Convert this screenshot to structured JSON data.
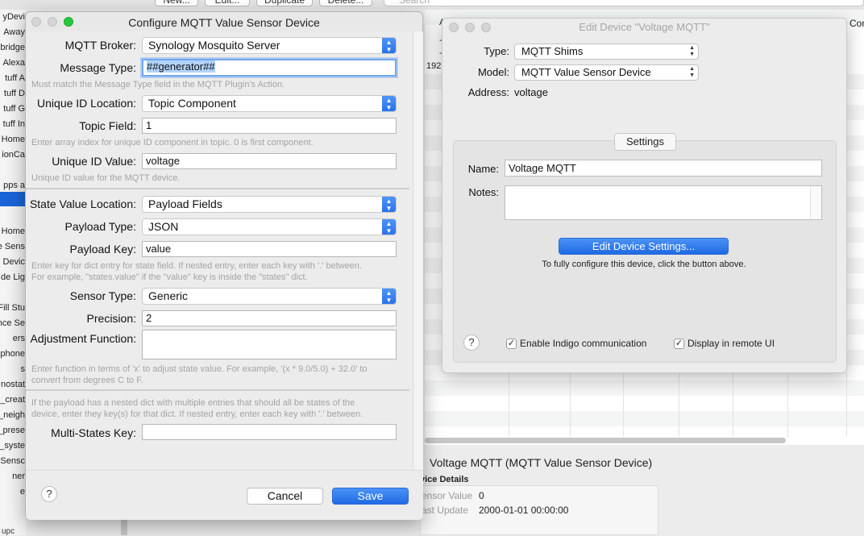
{
  "background": {
    "toolbar_buttons": [
      "New...",
      "Edit...",
      "Duplicate",
      "Delete..."
    ],
    "search_placeholder": "Search",
    "column_header_partial": "Con",
    "sidebar_items": [
      "yDevi",
      "Away",
      "bridge",
      "Alexa",
      "tuff A",
      "tuff D",
      "tuff G",
      "tuff In",
      "Home",
      "ionCa",
      "",
      "pps a",
      "",
      "",
      "Home",
      "e Sens",
      "Devic",
      "de Lig",
      "",
      "Fill Stu",
      "nce Se",
      "ers",
      "phone",
      "s",
      "nostat",
      "_creat",
      "_neigh",
      "_prese",
      "_syste",
      "Sensc",
      "ner",
      "e"
    ],
    "list_partial_letters": [
      "A",
      "-",
      "-",
      "192"
    ],
    "detail": {
      "title": "Voltage MQTT (MQTT Value Sensor Device)",
      "section": "vice Details",
      "rows": [
        {
          "key": "ensor Value",
          "value": "0"
        },
        {
          "key": "ast Update",
          "value": "2000-01-01 00:00:00"
        }
      ],
      "bottom_left": "upc"
    }
  },
  "config_dialog": {
    "title": "Configure MQTT Value Sensor Device",
    "broker": {
      "label": "MQTT Broker:",
      "value": "Synology Mosquito Server"
    },
    "message_type": {
      "label": "Message Type:",
      "value": "##generator##",
      "hint": "Must match the Message Type field in the MQTT Plugin's Action."
    },
    "unique_id_location": {
      "label": "Unique ID Location:",
      "value": "Topic Component"
    },
    "topic_field": {
      "label": "Topic Field:",
      "value": "1",
      "hint": "Enter array index for unique ID component in topic.  0 is first component."
    },
    "unique_id_value": {
      "label": "Unique ID Value:",
      "value": "voltage",
      "hint": "Unique ID value for the MQTT device."
    },
    "state_value_location": {
      "label": "State Value Location:",
      "value": "Payload Fields"
    },
    "payload_type": {
      "label": "Payload Type:",
      "value": "JSON"
    },
    "payload_key": {
      "label": "Payload Key:",
      "value": "value",
      "hint1": "Enter key for dict entry for state field.  If nested entry, enter each key with '.' between.",
      "hint2": "For example, \"states.value\" if the \"value\" key is inside the \"states\" dict."
    },
    "sensor_type": {
      "label": "Sensor Type:",
      "value": "Generic"
    },
    "precision": {
      "label": "Precision:",
      "value": "2"
    },
    "adjustment_function": {
      "label": "Adjustment Function:",
      "value": "",
      "hint1": "Enter function in terms of 'x' to adjust state value. For example, '(x * 9.0/5.0) + 32.0' to",
      "hint2": "convert from degrees C to F."
    },
    "multi_states_hint1": "If the payload has a nested dict with multiple entries that should all be states of the",
    "multi_states_hint2": "device, enter they key(s) for that dict.  If nested entry, enter each key with '.' between.",
    "multi_states_key": {
      "label": "Multi-States Key:",
      "value": ""
    },
    "help_label": "?",
    "cancel_label": "Cancel",
    "save_label": "Save"
  },
  "edit_device": {
    "title": "Edit Device \"Voltage MQTT\"",
    "type_label": "Type:",
    "type_value": "MQTT Shims",
    "model_label": "Model:",
    "model_value": "MQTT Value Sensor Device",
    "address_label": "Address:",
    "address_value": "voltage",
    "settings_label": "Settings",
    "name_label": "Name:",
    "name_value": "Voltage MQTT",
    "notes_label": "Notes:",
    "notes_value": "",
    "edit_settings_button": "Edit Device Settings...",
    "configure_hint": "To fully configure this device, click the button above.",
    "help_label": "?",
    "enable_comm_label": "Enable Indigo communication",
    "enable_comm_checked": true,
    "remote_ui_label": "Display in remote UI",
    "remote_ui_checked": true
  }
}
